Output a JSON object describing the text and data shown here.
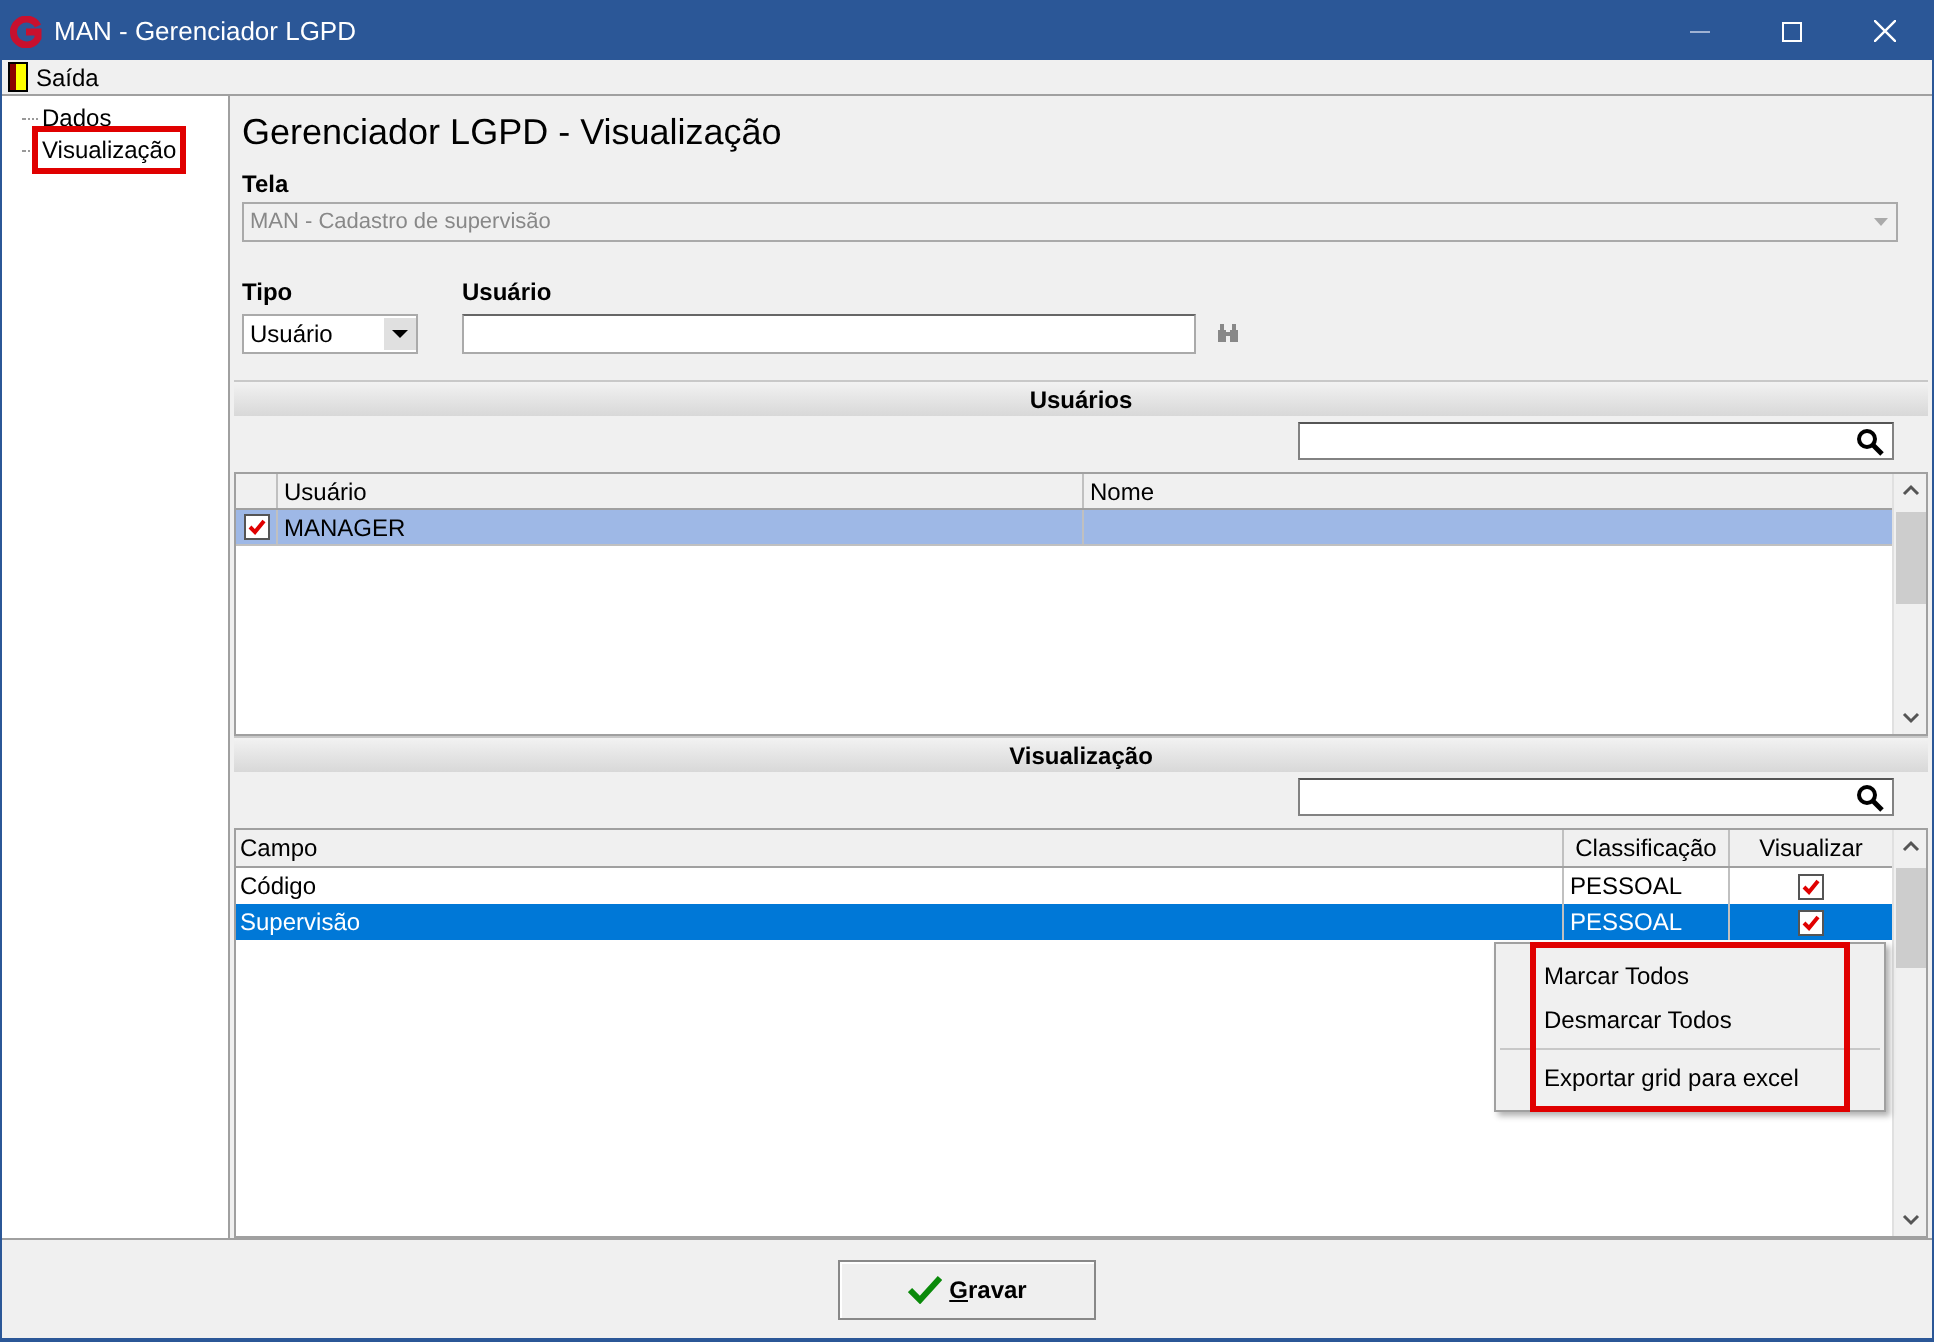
{
  "window": {
    "title": "MAN - Gerenciador LGPD"
  },
  "menu": [
    {
      "label": "Saída"
    }
  ],
  "tree": [
    {
      "label": "Dados",
      "highlighted": false
    },
    {
      "label": "Visualização",
      "highlighted": true
    }
  ],
  "heading": "Gerenciador LGPD - Visualização",
  "tela": {
    "label": "Tela",
    "value": "MAN - Cadastro de supervisão",
    "disabled": true
  },
  "tipo": {
    "label": "Tipo",
    "value": "Usuário"
  },
  "usuario": {
    "label": "Usuário"
  },
  "users_section": {
    "title": "Usuários",
    "columns": [
      "Usuário",
      "Nome"
    ],
    "rows": [
      {
        "usuario": "MANAGER",
        "checked": true,
        "selected": true
      }
    ]
  },
  "view_section": {
    "title": "Visualização",
    "columns": [
      "Campo",
      "Classificação",
      "Visualizar"
    ],
    "rows": [
      {
        "campo": "Código",
        "classificacao": "PESSOAL",
        "visualizar": true,
        "selected": false
      },
      {
        "campo": "Supervisão",
        "classificacao": "PESSOAL",
        "visualizar": true,
        "selected": true
      }
    ]
  },
  "context_menu": {
    "highlighted": true,
    "items": [
      {
        "label": "Marcar Todos",
        "kind": "item"
      },
      {
        "label": "Desmarcar Todos",
        "kind": "item"
      },
      {
        "kind": "separator"
      },
      {
        "label": "Exportar grid para excel",
        "kind": "item"
      }
    ]
  },
  "save_button": {
    "label": "Gravar"
  }
}
